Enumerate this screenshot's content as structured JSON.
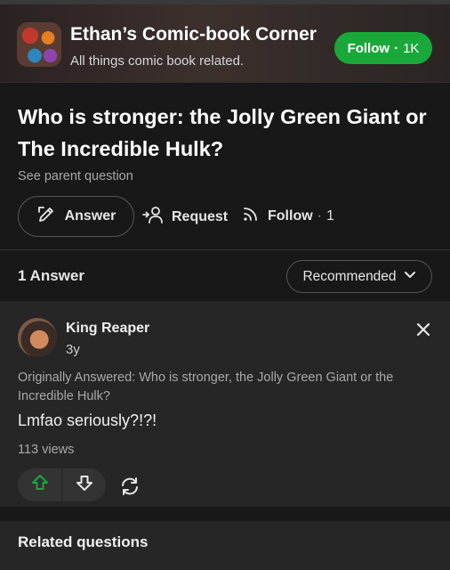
{
  "space": {
    "name": "Ethan’s Comic-book Corner",
    "description": "All things comic book related.",
    "follow_label": "Follow",
    "follow_separator": "·",
    "follow_count": "1K",
    "follow_color": "#1aa83a"
  },
  "question": {
    "title": "Who is stronger: the Jolly Green Giant or The Incredible Hulk?",
    "parent_link": "See parent question",
    "actions": {
      "answer_label": "Answer",
      "request_label": "Request",
      "follow_label": "Follow",
      "follow_separator": "·",
      "follow_count": "1"
    }
  },
  "answers": {
    "count_label": "1 Answer",
    "sort_value": "Recommended"
  },
  "answer": {
    "author_name": "King Reaper",
    "time_ago": "3y",
    "originally_answered": "Originally Answered: Who is stronger, the Jolly Green Giant or the Incredible Hulk?",
    "body": "Lmfao seriously?!?!",
    "views": "113 views",
    "upvote_color": "#1aa83a"
  },
  "related": {
    "title": "Related questions"
  },
  "icons": {
    "answer": "edit-pencil-icon",
    "request": "request-person-icon",
    "follow": "follow-wifi-icon",
    "sort": "chevron-down-icon",
    "close": "close-icon",
    "upvote": "upvote-arrow-icon",
    "downvote": "downvote-arrow-icon",
    "share": "reshare-icon"
  }
}
